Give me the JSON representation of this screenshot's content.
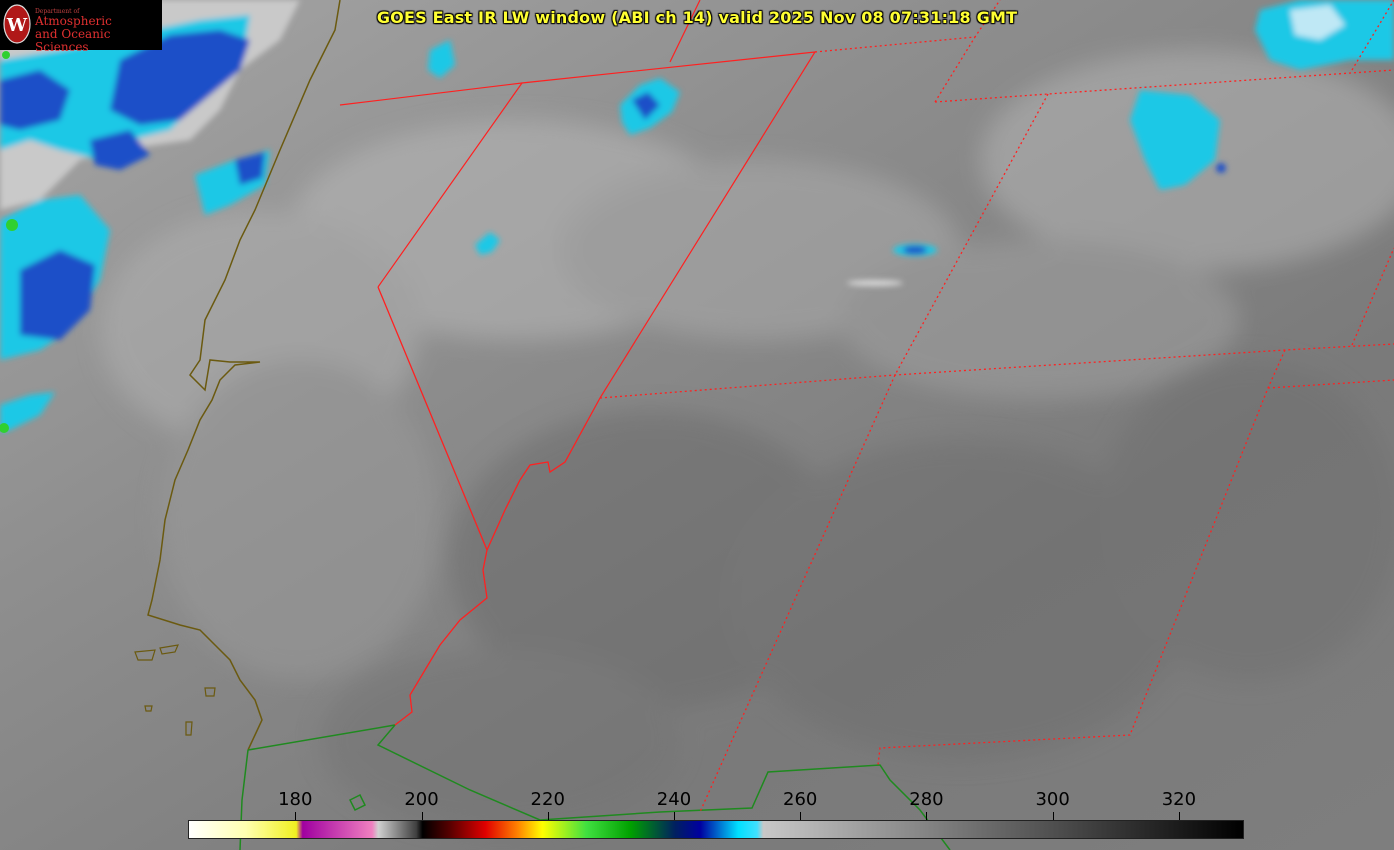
{
  "title": "GOES East IR LW window (ABI ch 14) valid 2025 Nov 08 07:31:18 GMT",
  "logo": {
    "department": "Department of",
    "line1": "Atmospheric",
    "line2": "and Oceanic Sciences",
    "seal_letter": "W"
  },
  "colorbar": {
    "min": 163,
    "max": 330,
    "ticks": [
      "180",
      "200",
      "220",
      "240",
      "260",
      "280",
      "300",
      "320"
    ],
    "tick_values": [
      180,
      200,
      220,
      240,
      260,
      280,
      300,
      320
    ],
    "unit": ""
  },
  "colors": {
    "background_gray": "#7a7a7a",
    "state_borders": "#ff2020",
    "coastline": "#6b5a10",
    "country_border": "#1f8a1f",
    "title_text": "#ffff33"
  }
}
